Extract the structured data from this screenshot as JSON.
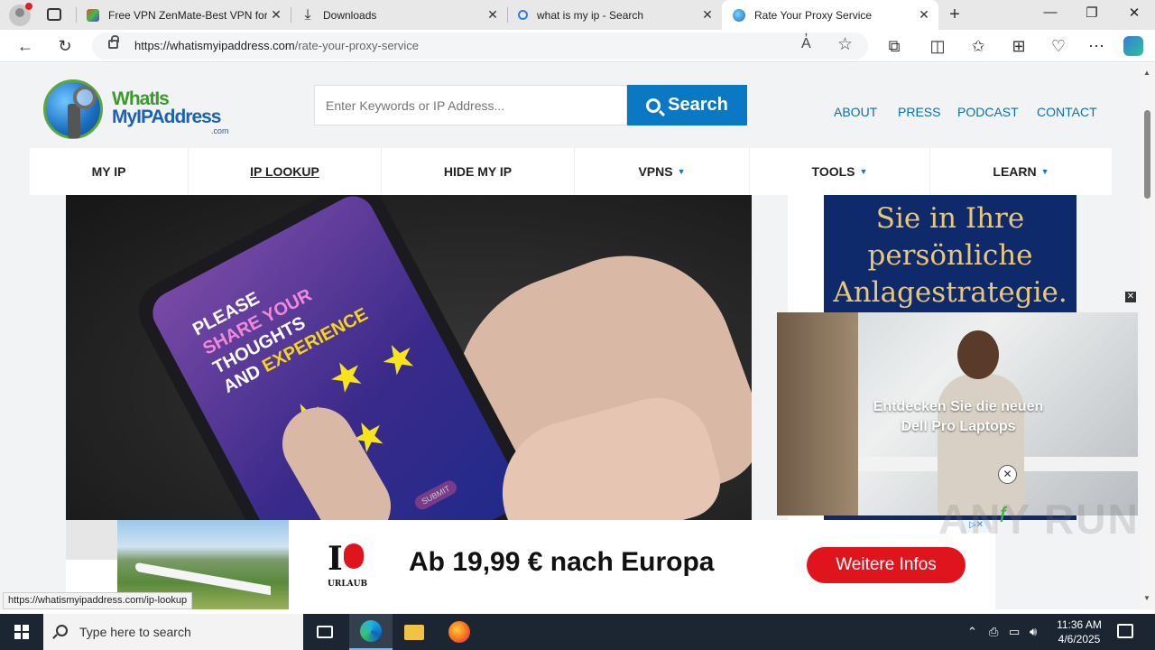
{
  "browser": {
    "tabs": [
      {
        "title": "Free VPN ZenMate-Best VPN for",
        "active": false
      },
      {
        "title": "Downloads",
        "active": false
      },
      {
        "title": "what is my ip - Search",
        "active": false
      },
      {
        "title": "Rate Your Proxy Service",
        "active": true
      }
    ],
    "tab_close": "✕",
    "new_tab": "+",
    "window_controls": {
      "minimize": "—",
      "restore": "❐",
      "close": "✕"
    },
    "url_host": "https://whatismyipaddress.com",
    "url_path": "/rate-your-proxy-service",
    "read_aloud": "A̓",
    "favorite": "☆",
    "status_url": "https://whatismyipaddress.com/ip-lookup"
  },
  "site": {
    "logo": {
      "line1": "WhatIs",
      "line2": "MyIPAddress",
      "line3": ".com"
    },
    "search": {
      "placeholder": "Enter Keywords or IP Address...",
      "button": "Search"
    },
    "top_links": [
      "ABOUT",
      "PRESS",
      "PODCAST",
      "CONTACT"
    ],
    "main_nav": [
      {
        "label": "MY IP",
        "caret": false
      },
      {
        "label": "IP LOOKUP",
        "caret": false
      },
      {
        "label": "HIDE MY IP",
        "caret": false
      },
      {
        "label": "VPNS",
        "caret": true
      },
      {
        "label": "TOOLS",
        "caret": true
      },
      {
        "label": "LEARN",
        "caret": true
      }
    ],
    "caret_glyph": "▼",
    "hero": {
      "line1": "PLEASE",
      "line2": "SHARE YOUR",
      "line3": "THOUGHTS",
      "line4": "AND",
      "line5": "EXPERIENCE",
      "submit": "SUBMIT"
    }
  },
  "ads": {
    "side_text": [
      "Sie in Ihre",
      "persönliche",
      "Anlagestrategie."
    ],
    "video_caption_1": "Entdecken Sie die neuen",
    "video_caption_2": "Dell Pro Laptops",
    "video_close": "✕",
    "bottom": {
      "brand_top": "I",
      "brand_bottom": "URLAUB",
      "headline": "Ab 19,99 € nach Europa",
      "cta": "Weitere Infos",
      "adchoices": "▷✕",
      "close": "✕"
    }
  },
  "watermark": "ANY RUN",
  "taskbar": {
    "search_placeholder": "Type here to search",
    "time": "11:36 AM",
    "date": "4/6/2025",
    "tray_up": "⌃"
  },
  "colors": {
    "accent": "#0a78c2",
    "nav_link": "#0a6fb0",
    "ad_red": "#e0141c"
  }
}
